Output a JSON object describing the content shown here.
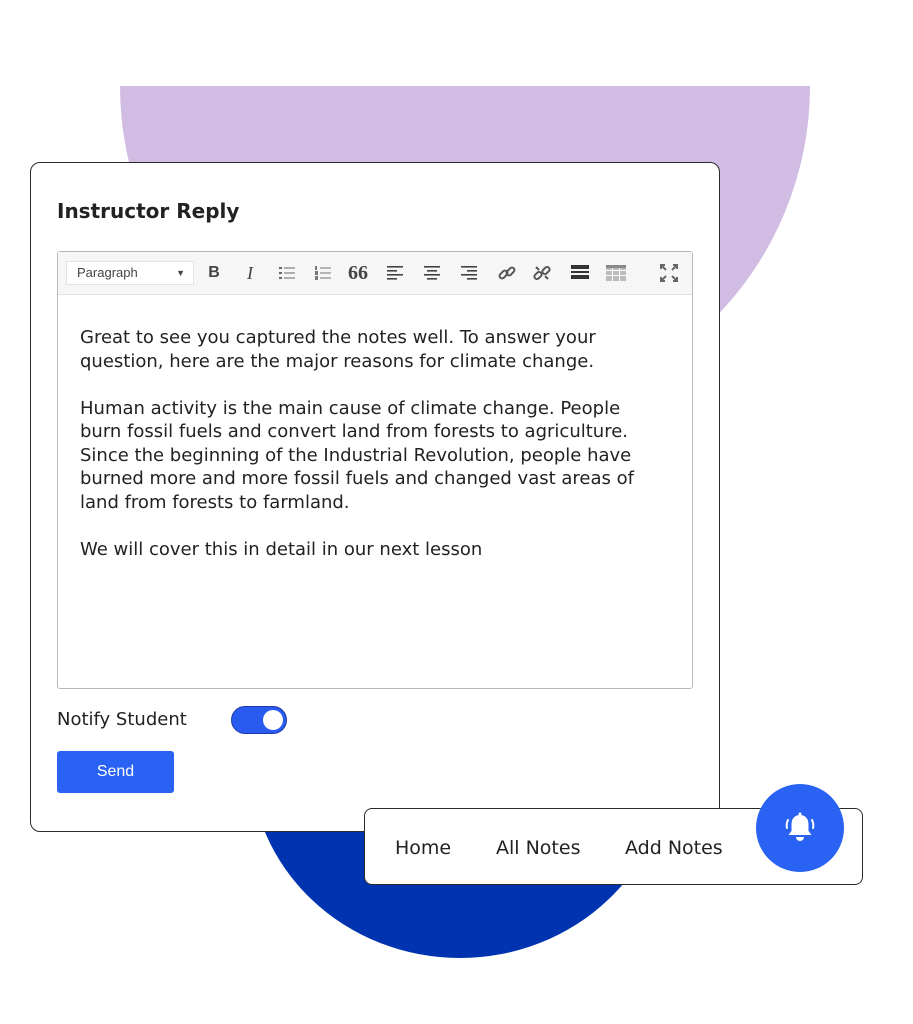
{
  "card": {
    "title": "Instructor Reply"
  },
  "editor": {
    "format_select": "Paragraph",
    "toolbar_icons": [
      "bold-icon",
      "italic-icon",
      "bullet-list-icon",
      "numbered-list-icon",
      "blockquote-icon",
      "align-left-icon",
      "align-center-icon",
      "align-right-icon",
      "link-icon",
      "unlink-icon",
      "read-more-icon",
      "table-icon",
      "fullscreen-icon"
    ],
    "bold_glyph": "B",
    "italic_glyph": "I",
    "quote_glyph": "66",
    "paragraphs": [
      "Great to see you captured the notes well. To answer your question, here are the major reasons for climate change.",
      "Human activity is the main cause of climate change. People burn fossil fuels and convert land from forests to agriculture. Since the beginning of the Industrial Revolution, people have burned more and more fossil fuels and changed vast areas of land from forests to farmland.",
      "We will cover this in detail in our next lesson"
    ]
  },
  "notify": {
    "label": "Notify Student",
    "enabled": true
  },
  "send_label": "Send",
  "nav": {
    "items": [
      "Home",
      "All Notes",
      "Add Notes"
    ],
    "bell_icon": "bell-icon"
  },
  "colors": {
    "accent": "#2a62f4",
    "deco_purple": "#d1bde3",
    "deco_blue": "#0033b0"
  }
}
